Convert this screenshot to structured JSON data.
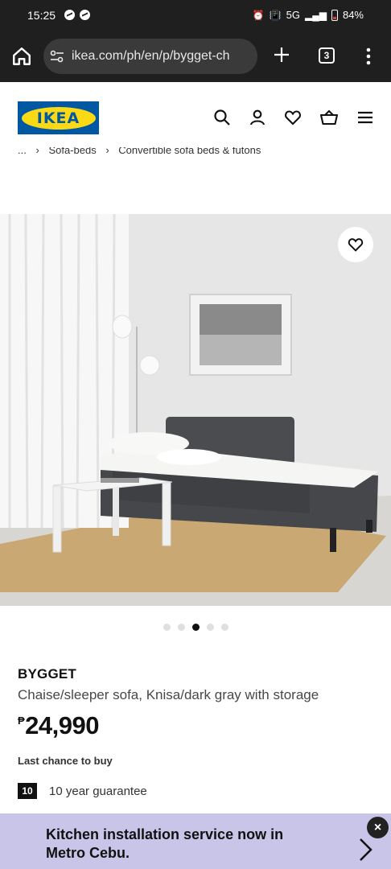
{
  "status_bar": {
    "time": "15:25",
    "network": "5G",
    "battery": "84%"
  },
  "browser": {
    "url": "ikea.com/ph/en/p/bygget-ch",
    "tab_count": "3"
  },
  "header": {
    "logo_text": "IKEA",
    "icons": [
      "search-icon",
      "user-icon",
      "heart-icon",
      "basket-icon",
      "menu-icon"
    ]
  },
  "breadcrumb": {
    "ellipsis": "...",
    "items": [
      "Sofa-beds",
      "Convertible sofa beds & futons"
    ]
  },
  "gallery": {
    "image_count": 5,
    "active_index": 2
  },
  "product": {
    "name": "BYGGET",
    "description": "Chaise/sleeper sofa, Knisa/dark gray with storage",
    "currency": "₱",
    "price": "24,990",
    "availability": "Last chance to buy",
    "guarantee_years": "10",
    "guarantee_text": "10 year guarantee"
  },
  "promo": {
    "text": "Kitchen installation service now in Metro Cebu.",
    "close_label": "×"
  },
  "colors": {
    "ikea_blue": "#0058a3",
    "ikea_yellow": "#fbd914",
    "promo_bg": "#c9c5e8",
    "sofa_gray": "#4a4c50"
  }
}
